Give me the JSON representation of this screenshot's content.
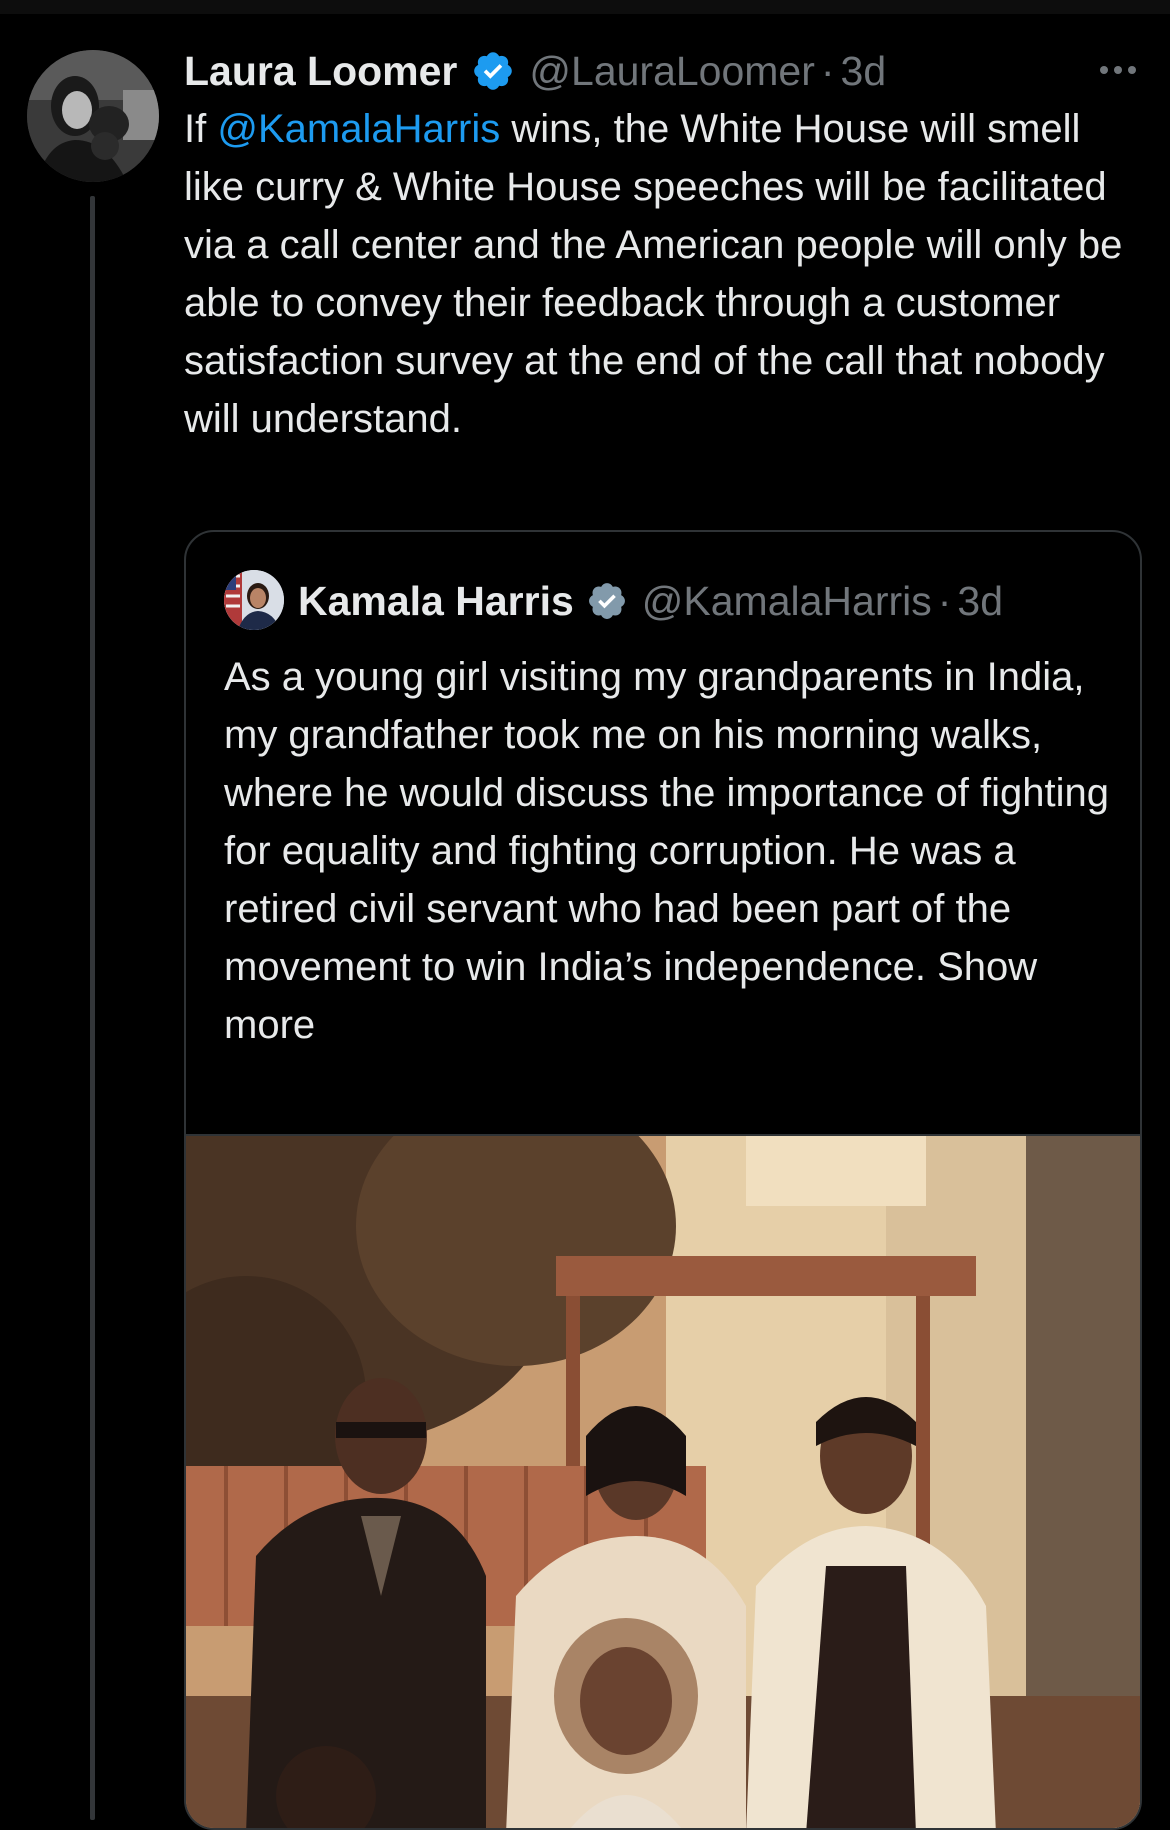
{
  "tweet": {
    "display_name": "Laura Loomer",
    "handle": "@LauraLoomer",
    "separator": "·",
    "time": "3d",
    "verified_icon": "verified-badge-icon",
    "more_icon": "more-options-icon",
    "text_before": "If ",
    "mention": "@KamalaHarris",
    "text_after": " wins, the White House will smell like curry & White House speeches will be facilitated via a call center and the American people will only be able to convey their feedback through a customer satisfaction survey at the end of the call that nobody will understand."
  },
  "quote": {
    "display_name": "Kamala Harris",
    "handle": "@KamalaHarris",
    "separator": "·",
    "time": "3d",
    "verified_icon": "verified-badge-icon",
    "text": "As a young girl visiting my grandparents in India, my grandfather took me on his morning walks, where he would discuss the importance of fighting for equality and fighting corruption. He was a retired civil servant who had been part of the movement to win India’s independence.",
    "show_more": "Show more"
  },
  "colors": {
    "background": "#000000",
    "text": "#e7e9ea",
    "secondary": "#71767b",
    "link": "#1d9bf0",
    "verified_blue": "#1d9bf0",
    "border": "#2f3336"
  }
}
